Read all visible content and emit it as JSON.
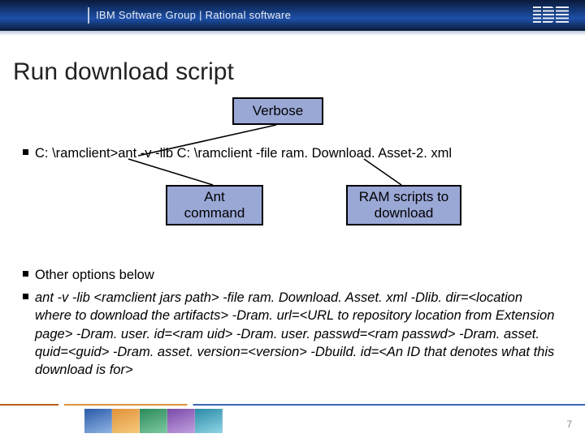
{
  "header": {
    "label": "IBM Software Group | Rational software",
    "logo_name": "ibm-logo"
  },
  "title": "Run download script",
  "callouts": {
    "verbose": "Verbose",
    "ant": "Ant command",
    "ram": "RAM scripts to download"
  },
  "bullets": {
    "cmd": "C: \\ramclient>ant -v -lib C: \\ramclient -file ram. Download. Asset-2. xml",
    "other": "Other options below",
    "long": "ant -v -lib <ramclient jars path> -file ram. Download. Asset. xml -Dlib. dir=<location where to download the artifacts> -Dram. url=<URL to repository location from Extension page> -Dram. user. id=<ram uid> -Dram. user. passwd=<ram passwd> -Dram. asset. quid=<guid> -Dram. asset. version=<version> -Dbuild. id=<An ID that denotes what this download is for>"
  },
  "page_number": "7"
}
